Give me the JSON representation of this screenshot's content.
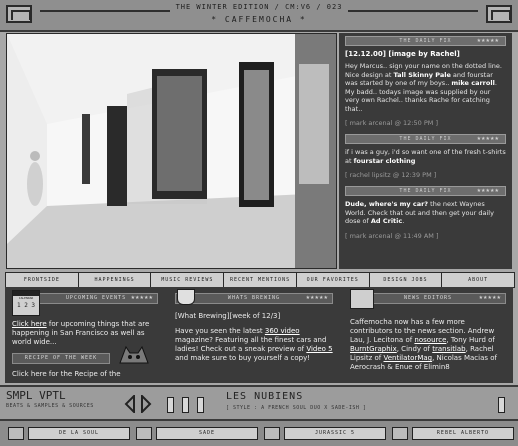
{
  "header": {
    "edition": "THE WINTER EDITION / CM:V6 / 023",
    "site_name": "* CAFFEMOCHA *"
  },
  "news": [
    {
      "bar_label": "THE DAILY FIX",
      "stars": "★★★★★",
      "title": "[12.12.00] [image by Rachel]",
      "text_parts": [
        "Hey Marcus.. sign your name on the dotted line. Nice design at ",
        "Tall Skinny Pale",
        " and fourstar was started by one of my boys.. ",
        "mike carroll",
        ". My badd.. todays image was supplied by our very own Rachel.. thanks Rache for catching that.."
      ],
      "meta": "[ mark arcenal @ 12:50 PM ]"
    },
    {
      "bar_label": "THE DAILY FIX",
      "stars": "★★★★★",
      "text_parts": [
        "if i was a guy, i'd so want one of the fresh t-shirts at ",
        "fourstar clothing"
      ],
      "meta": "[ rachel lipsitz @ 12:39 PM ]"
    },
    {
      "bar_label": "THE DAILY FIX",
      "stars": "★★★★★",
      "text_parts": [
        "Dude, where's my car?",
        " the next Waynes World. Check that out and then get your daily dose of ",
        "Ad Critic",
        "."
      ],
      "meta": "[ mark arcenal @ 11:49 AM ]"
    }
  ],
  "nav": [
    "FRONTSIDE",
    "HAPPENINGS",
    "MUSIC REVIEWS",
    "RECENT MENTIONS",
    "OUR FAVORITES",
    "DESIGN JOBS",
    "ABOUT"
  ],
  "panels": {
    "events": {
      "bar": "UPCOMING EVENTS",
      "stars": "★★★★★",
      "calendar_label": "CALENDAR",
      "link": "Click here",
      "text": " for upcoming things that are happening in San Francisco as well as world wide..."
    },
    "recipe": {
      "bar": "RECIPE OF THE WEEK",
      "text": "Click here for the Recipe of the"
    },
    "brewing": {
      "bar": "WHATS BREWING",
      "stars": "★★★★★",
      "head": "[What Brewing][week of 12/3]",
      "t1": "Have you seen the latest ",
      "l1": "360 video",
      "t2": " magazine? Featuring all the finest cars and ladies! Check out a sneak preview of ",
      "l2": "Video 5",
      "t3": " and make sure to buy yourself a copy!"
    },
    "editors": {
      "bar": "NEWS EDITORS",
      "stars": "★★★★★",
      "t1": "Caffemocha now has a few more contributors to the news section. Andrew Lau, J. Lecitona of ",
      "l1": "nosource",
      "t2": ", Tony Hurd of ",
      "l2": "BurntGraphix",
      "t3": ", Cindy of ",
      "l3": "transitlab",
      "t4": ", Rachel Lipsitz of ",
      "l4": "VentilatorMag",
      "t5": ", Nicolas Macias of Aerocrash & Enue of Elimin8"
    }
  },
  "player": {
    "brand": "SMPL VPTL",
    "brand_sub": "BEATS & SAMPLES & SOURCES",
    "now_playing": "LES NUBIENS",
    "now_sub": "[ STYLE : A FRENCH SOUL DUO X SADE-ISH ]"
  },
  "tabs": [
    "DE LA SOUL",
    "SADE",
    "JURASSIC 5",
    "REBEL ALBERTO"
  ]
}
